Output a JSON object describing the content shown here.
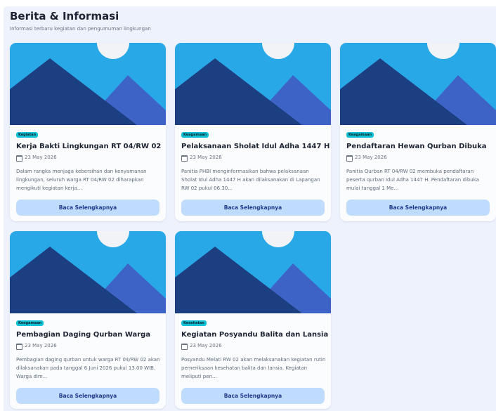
{
  "header": {
    "title": "Berita & Informasi",
    "subtitle": "Informasi terbaru kegiatan dan pengumuman lingkungan"
  },
  "cards": [
    {
      "category": "Kegiatan",
      "title": "Kerja Bakti Lingkungan RT 04/RW 02",
      "date": "23 May 2026",
      "excerpt": "Dalam rangka menjaga kebersihan dan kenyamanan lingkungan, seluruh warga RT 04/RW 02 diharapkan mengikuti kegiatan kerja...",
      "button": "Baca Selengkapnya"
    },
    {
      "category": "Keagamaan",
      "title": "Pelaksanaan Sholat Idul Adha 1447 H",
      "date": "23 May 2026",
      "excerpt": "Panitia PHBI menginformasikan bahwa pelaksanaan Sholat Idul Adha 1447 H akan dilaksanakan di Lapangan RW 02 pukul 06.30...",
      "button": "Baca Selengkapnya"
    },
    {
      "category": "Keagamaan",
      "title": "Pendaftaran Hewan Qurban Dibuka",
      "date": "23 May 2026",
      "excerpt": "Panitia Qurban RT 04/RW 02 membuka pendaftaran peserta qurban Idul Adha 1447 H. Pendaftaran dibuka mulai tanggal 1 Me...",
      "button": "Baca Selengkapnya"
    },
    {
      "category": "Keagamaan",
      "title": "Pembagian Daging Qurban Warga",
      "date": "23 May 2026",
      "excerpt": "Pembagian daging qurban untuk warga RT 04/RW 02 akan dilaksanakan pada tanggal 6 Juni 2026 pukul 13.00 WIB. Warga dim...",
      "button": "Baca Selengkapnya"
    },
    {
      "category": "Kesehatan",
      "title": "Kegiatan Posyandu Balita dan Lansia",
      "date": "23 May 2026",
      "excerpt": "Posyandu Melati RW 02 akan melaksanakan kegiatan rutin pemeriksaan kesehatan balita dan lansia. Kegiatan meliputi pen...",
      "button": "Baca Selengkapnya"
    }
  ],
  "theme": {
    "sky": "#29a8e8",
    "mountain_dark": "#1c3f82",
    "mountain_light": "#3e63c6",
    "sun": "#f1f3f6",
    "badge": "#12c1d6",
    "button_bg": "#bfdbfe",
    "button_text": "#1f3a8a",
    "icons": {
      "placeholder_image": "image-placeholder-icon",
      "date": "calendar-icon"
    }
  }
}
